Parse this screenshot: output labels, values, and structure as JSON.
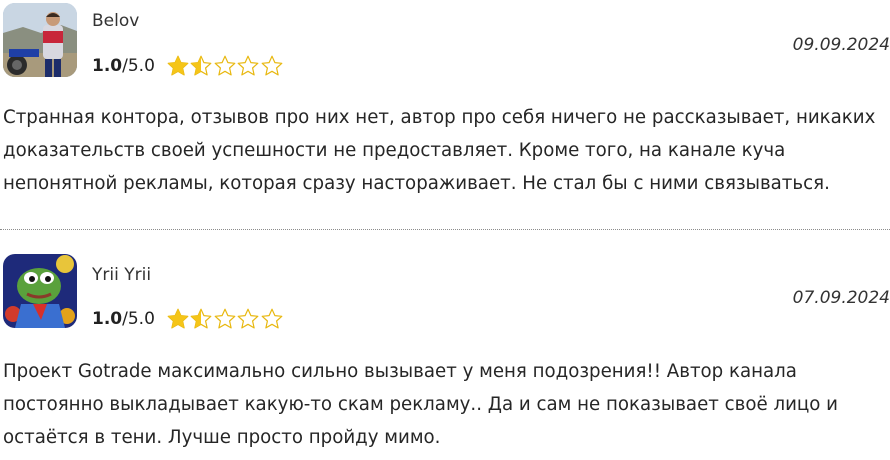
{
  "reviews": [
    {
      "author": "Belov",
      "score": "1.0",
      "max": "/5.0",
      "rating": 1.5,
      "date": "09.09.2024",
      "avatar_icon": "motorcycle-rider-photo",
      "text": "Странная контора, отзывов про них нет, автор про себя ничего не рассказывает, никаких доказательств своей успешности не предоставляет. Кроме того, на канале куча непонятной рекламы, которая сразу настораживает. Не стал бы с ними связываться."
    },
    {
      "author": "Yrii Yrii",
      "score": "1.0",
      "max": "/5.0",
      "rating": 1.5,
      "date": "07.09.2024",
      "avatar_icon": "frog-cartoon-avatar",
      "text": "Проект Gotrade максимально сильно вызывает у меня подозрения!! Автор канала постоянно выкладывает какую-то скам рекламу.. Да и сам не показывает своё лицо и остаётся в тени. Лучше просто пройду мимо."
    }
  ],
  "colors": {
    "star_fill": "#f5c518",
    "star_outline": "#e8b810",
    "divider": "#8c8c8c"
  }
}
